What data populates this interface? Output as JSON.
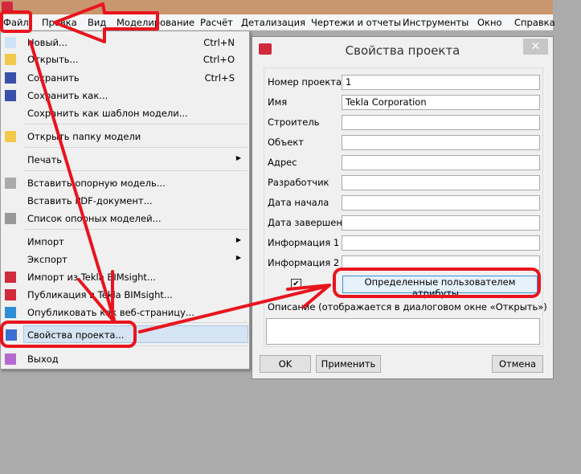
{
  "menubar": {
    "items": [
      "Файл",
      "Правка",
      "Вид",
      "Моделирование",
      "Расчёт",
      "Детализация",
      "Чертежи и отчеты",
      "Инструменты",
      "Окно",
      "Справка"
    ]
  },
  "file_menu": {
    "items": [
      {
        "label": "Новый...",
        "shortcut": "Ctrl+N",
        "icon": "new-file-icon"
      },
      {
        "label": "Открыть...",
        "shortcut": "Ctrl+O",
        "icon": "open-folder-icon"
      },
      {
        "label": "Сохранить",
        "shortcut": "Ctrl+S",
        "icon": "save-icon"
      },
      {
        "label": "Сохранить как...",
        "icon": "save-as-icon"
      },
      {
        "label": "Сохранить как шаблон модели..."
      },
      {
        "label": "Открыть папку модели",
        "icon": "open-model-folder-icon"
      },
      {
        "label": "Печать",
        "submenu": true
      },
      {
        "label": "Вставить опорную модель...",
        "icon": "reference-model-icon"
      },
      {
        "label": "Вставить PDF-документ..."
      },
      {
        "label": "Список опорных моделей...",
        "icon": "reference-list-icon"
      },
      {
        "label": "Импорт",
        "submenu": true
      },
      {
        "label": "Экспорт",
        "submenu": true
      },
      {
        "label": "Импорт из Tekla BIMsight...",
        "icon": "tekla-icon"
      },
      {
        "label": "Публикация в Tekla BIMsight...",
        "icon": "tekla-icon"
      },
      {
        "label": "Опубликовать как веб-страницу...",
        "icon": "globe-icon"
      },
      {
        "label": "Свойства проекта...",
        "icon": "properties-icon",
        "highlighted": true
      },
      {
        "label": "Выход",
        "icon": "exit-icon"
      }
    ]
  },
  "dialog": {
    "title": "Свойства проекта",
    "close": "✕",
    "fields": [
      {
        "label": "Номер проекта",
        "value": "1"
      },
      {
        "label": "Имя",
        "value": "Tekla Corporation"
      },
      {
        "label": "Строитель",
        "value": ""
      },
      {
        "label": "Объект",
        "value": ""
      },
      {
        "label": "Адрес",
        "value": ""
      },
      {
        "label": "Разработчик",
        "value": ""
      },
      {
        "label": "Дата начала",
        "value": ""
      },
      {
        "label": "Дата завершения",
        "value": ""
      },
      {
        "label": "Информация 1",
        "value": ""
      },
      {
        "label": "Информация 2",
        "value": ""
      }
    ],
    "checkbox_checked": true,
    "checkmark": "✔",
    "uda_button": "Определенные пользователем атрибуты...",
    "description_label": "Описание (отображается в диалоговом окне «Открыть»)",
    "description_value": "",
    "ok": "OK",
    "apply": "Применить",
    "cancel": "Отмена"
  },
  "annotation_color": "#e8141e"
}
